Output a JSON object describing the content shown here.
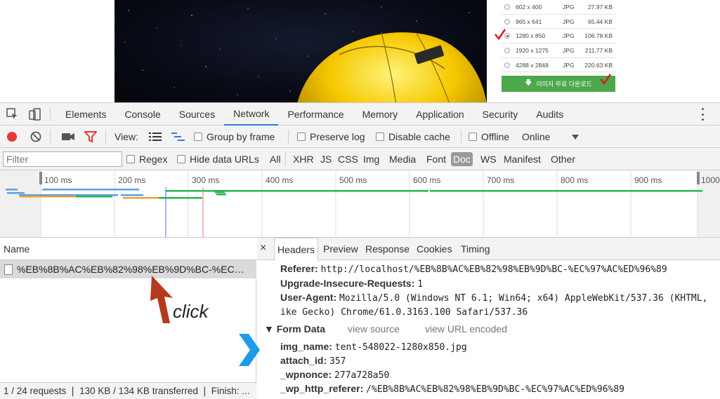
{
  "page": {
    "sizes": [
      {
        "dim": "602 x 400",
        "fmt": "JPG",
        "kb": "27.97 KB",
        "selected": false
      },
      {
        "dim": "965 x 641",
        "fmt": "JPG",
        "kb": "65.44 KB",
        "selected": false
      },
      {
        "dim": "1280 x 850",
        "fmt": "JPG",
        "kb": "106.78 KB",
        "selected": true
      },
      {
        "dim": "1920 x 1275",
        "fmt": "JPG",
        "kb": "211.77 KB",
        "selected": false
      },
      {
        "dim": "4288 x 2848",
        "fmt": "JPG",
        "kb": "220.63 KB",
        "selected": false
      }
    ],
    "download_label": "이미지 무료 다운로드"
  },
  "devtools": {
    "tabs": [
      "Elements",
      "Console",
      "Sources",
      "Network",
      "Performance",
      "Memory",
      "Application",
      "Security",
      "Audits"
    ],
    "active_tab": "Network",
    "toolbar": {
      "view_label": "View:",
      "group_by_frame": "Group by frame",
      "preserve_log": "Preserve log",
      "disable_cache": "Disable cache",
      "offline": "Offline",
      "online": "Online"
    },
    "filter": {
      "placeholder": "Filter",
      "regex": "Regex",
      "hide_data_urls": "Hide data URLs",
      "types": [
        "All",
        "XHR",
        "JS",
        "CSS",
        "Img",
        "Media",
        "Font",
        "Doc",
        "WS",
        "Manifest",
        "Other"
      ],
      "active_type": "Doc"
    },
    "timeline": {
      "ticks": [
        "100 ms",
        "200 ms",
        "300 ms",
        "400 ms",
        "500 ms",
        "600 ms",
        "700 ms",
        "800 ms",
        "900 ms",
        "1000"
      ]
    },
    "request_list": {
      "header": "Name",
      "rows": [
        "%EB%8B%AC%EB%82%98%EB%9D%BC-%EC%97..."
      ],
      "annotation": "click",
      "status": "1 / 24 requests  ❘  130 KB / 134 KB transferred  ❘  Finish: ..."
    },
    "detail": {
      "close": "×",
      "tabs": [
        "Headers",
        "Preview",
        "Response",
        "Cookies",
        "Timing"
      ],
      "active_tab": "Headers",
      "headers": [
        {
          "key": "Referer:",
          "value": "http://localhost/%EB%8B%AC%EB%82%98%EB%9D%BC-%EC%97%AC%ED%96%89"
        },
        {
          "key": "Upgrade-Insecure-Requests:",
          "value": "1"
        },
        {
          "key": "User-Agent:",
          "value": "Mozilla/5.0 (Windows NT 6.1; Win64; x64) AppleWebKit/537.36 (KHTML,"
        },
        {
          "key": "",
          "value": "ike Gecko) Chrome/61.0.3163.100 Safari/537.36"
        }
      ],
      "form_data_title": "▼ Form Data",
      "view_source": "view source",
      "view_url_encoded": "view URL encoded",
      "form_data": [
        {
          "key": "img_name:",
          "value": "tent-548022-1280x850.jpg"
        },
        {
          "key": "attach_id:",
          "value": "357"
        },
        {
          "key": "_wpnonce:",
          "value": "277a728a50"
        },
        {
          "key": "_wp_http_referer:",
          "value": "/%EB%8B%AC%EB%82%98%EB%9D%BC-%EC%97%AC%ED%96%89"
        }
      ]
    }
  },
  "colors": {
    "accent": "#3879d9",
    "record": "#e53935",
    "download_green": "#4ca84a",
    "annotation_arrow": "#b33a1c",
    "chevron": "#1e9be8"
  }
}
